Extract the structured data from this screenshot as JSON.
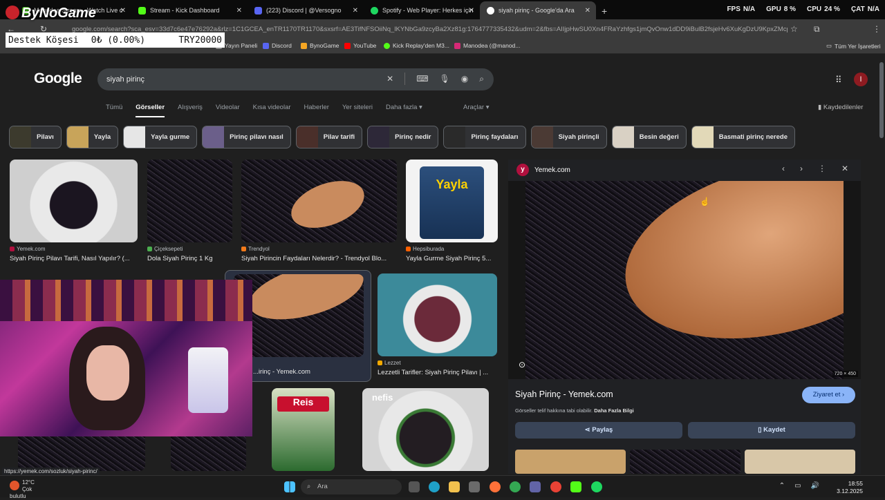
{
  "tabs": [
    {
      "title": "Manodea Stream - Watch Live c",
      "color": "#53fc18"
    },
    {
      "title": "Stream - Kick Dashboard",
      "color": "#53fc18"
    },
    {
      "title": "(223) Discord | @Versogno",
      "color": "#5865f2"
    },
    {
      "title": "Spotify - Web Player: Herkes için",
      "color": "#1ed760"
    },
    {
      "title": "siyah pirinç - Google'da Ara",
      "color": "#4285f4"
    }
  ],
  "new_tab": "+",
  "hw": {
    "fps_label": "FPS",
    "fps": "N/A",
    "gpu_label": "GPU",
    "gpu": "8 %",
    "cpu_label": "CPU",
    "cpu": "24 %",
    "cat_label": "ÇAT",
    "cat": "N/A"
  },
  "address": {
    "url": "google.com/search?sca_esv=33d7c6e47e76292a&rlz=1C1GCEA_enTR1170TR1170&sxsrf=AE3TifNFSOiiNq_lKYNbGa9zcyBa2Xz81g:1764777335432&udm=2&fbs=AIIjpHwSU0Xn4FRaYzhfgs1jmQvOnw1dDD9iBulB2fsjeHv6XuKgDzU9KpxZMcpsjQNb1..."
  },
  "bookmarks": [
    {
      "label": "Yayın Paneli",
      "color": "#888"
    },
    {
      "label": "Discord",
      "color": "#5865f2"
    },
    {
      "label": "BynoGame",
      "color": "#f5a623"
    },
    {
      "label": "YouTube",
      "color": "#ff0000"
    },
    {
      "label": "Kick Replay'den M3...",
      "color": "#53fc18"
    },
    {
      "label": "Manodea (@manod...",
      "color": "#d62976"
    }
  ],
  "all_bookmarks": "Tüm Yer İşaretleri",
  "overlay": {
    "brand": "ByNoGame",
    "donate_label": "Destek Köşesi",
    "donate_amount": "0₺ (0.00%)",
    "donate_goal": "TRY20000"
  },
  "google": {
    "logo": "Google",
    "query": "siyah pirinç",
    "saved": "Kaydedilenler",
    "tools": "Araçlar ▾"
  },
  "filters": [
    "Tümü",
    "Görseller",
    "Alışveriş",
    "Videolar",
    "Kısa videolar",
    "Haberler",
    "Yer siteleri",
    "Daha fazla ▾"
  ],
  "chips": [
    {
      "label": "Pilavı",
      "color": "#3c3a2d"
    },
    {
      "label": "Yayla",
      "color": "#c8a45a"
    },
    {
      "label": "Yayla gurme",
      "color": "#e6e6e6"
    },
    {
      "label": "Pirinç pilavı nasıl",
      "color": "#6b5f8a"
    },
    {
      "label": "Pilav tarifi",
      "color": "#4a2f2a"
    },
    {
      "label": "Pirinç nedir",
      "color": "#2d2838"
    },
    {
      "label": "Pirinç faydaları",
      "color": "#2a2a2a"
    },
    {
      "label": "Siyah pirinçli",
      "color": "#4b3a34"
    },
    {
      "label": "Besin değeri",
      "color": "#d9d1c4"
    },
    {
      "label": "Basmati pirinç nerede",
      "color": "#e2d9b8"
    }
  ],
  "results": [
    {
      "source": "Yemek.com",
      "caption": "Siyah Pirinç Pilavı Tarifi, Nasıl Yapılır? (...",
      "src_color": "#b0103e"
    },
    {
      "source": "Çiçeksepeti",
      "caption": "Dola Siyah Pirinç 1 Kg",
      "src_color": "#4caf50"
    },
    {
      "source": "Trendyol",
      "caption": "Siyah Pirincin Faydaları Nelerdir? - Trendyol Blo...",
      "src_color": "#f27a1a"
    },
    {
      "source": "Hepsiburada",
      "caption": "Yayla Gurme Siyah Pirinç 5...",
      "src_color": "#ff6000"
    },
    {
      "source": "Yemek.com",
      "caption": "...irinç - Yemek.com",
      "src_color": "#b0103e"
    },
    {
      "source": "Lezzet",
      "caption": "Lezzetli Tarifler: Siyah Pirinç Pilavı | ...",
      "src_color": "#f2a900"
    }
  ],
  "package_labels": {
    "yayla": "Yayla",
    "reis": "Reis",
    "nefis": "nefis"
  },
  "panel": {
    "site": "Yemek.com",
    "title": "Siyah Pirinç - Yemek.com",
    "visit": "Ziyaret et ›",
    "license": "Görseller telif hakkına tabi olabilir.",
    "license_more": "Daha Fazla Bilgi",
    "share": "Paylaş",
    "save": "Kaydet",
    "dims": "720 × 450"
  },
  "status_url": "https://yemek.com/sozluk/siyah-pirinc/",
  "taskbar": {
    "temp": "12°C",
    "weather": "Çok bulutlu",
    "search": "Ara",
    "time": "18:55",
    "date": "3.12.2025"
  }
}
